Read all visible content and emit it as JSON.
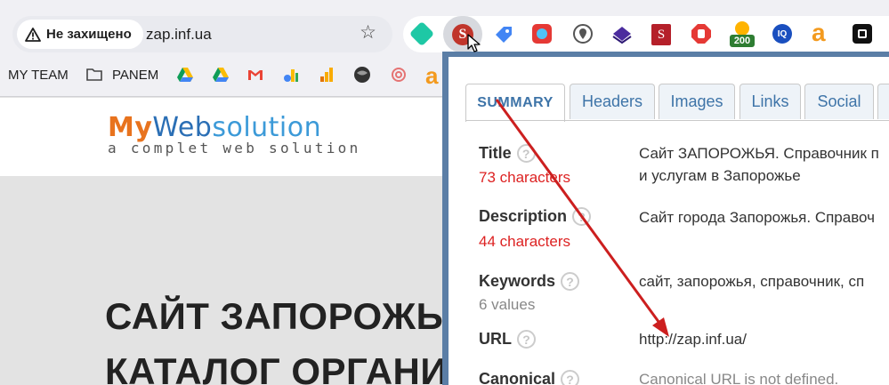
{
  "browser": {
    "security_label": "Не захищено",
    "url": "zap.inf.ua",
    "extensions": [
      {
        "name": "grammar-check-icon",
        "color": "#1ec8a5"
      },
      {
        "name": "seo-meta-icon",
        "color": "#c0352b",
        "label": "SEO"
      },
      {
        "name": "tag-icon",
        "color": "#4285f4"
      },
      {
        "name": "screenshot-icon",
        "color": "#e53935"
      },
      {
        "name": "location-icon",
        "color": "#555555"
      },
      {
        "name": "layers-icon",
        "color": "#4b2c9e"
      },
      {
        "name": "s-extension-icon",
        "color": "#b5202a",
        "label": "S"
      },
      {
        "name": "stop-hand-icon",
        "color": "#e53935"
      },
      {
        "name": "counter-badge-icon",
        "color": "#2e7d32",
        "label": "200"
      },
      {
        "name": "iq-icon",
        "color": "#1a4fbf",
        "label": "IQ"
      },
      {
        "name": "a-letter-icon",
        "color": "#f39a1e",
        "label": "a"
      },
      {
        "name": "chip-icon",
        "color": "#111111"
      }
    ]
  },
  "bookmarks": {
    "items": [
      {
        "label": "MY TEAM"
      },
      {
        "label": "PANEM"
      }
    ]
  },
  "site": {
    "logo_my": "My",
    "logo_web": "Web",
    "logo_solution": "solution",
    "logo_tagline": "a complet web solution",
    "hero_line1": "САЙТ ЗАПОРОЖЬ",
    "hero_line2": "КАТАЛОГ ОРГАНИ"
  },
  "popup": {
    "tabs": [
      {
        "label": "SUMMARY",
        "active": true
      },
      {
        "label": "Headers",
        "active": false
      },
      {
        "label": "Images",
        "active": false
      },
      {
        "label": "Links",
        "active": false
      },
      {
        "label": "Social",
        "active": false
      }
    ],
    "help_glyph": "?",
    "rows": {
      "title": {
        "label": "Title",
        "sub": "73 characters",
        "value_line1": "Сайт ЗАПОРОЖЬЯ. Справочник п",
        "value_line2": "и услугам в Запорожье"
      },
      "description": {
        "label": "Description",
        "sub": "44 characters",
        "value": "Сайт города Запорожья. Справоч"
      },
      "keywords": {
        "label": "Keywords",
        "sub": "6 values",
        "value": "сайт, запорожья, справочник, сп"
      },
      "url": {
        "label": "URL",
        "value": "http://zap.inf.ua/"
      },
      "canonical": {
        "label": "Canonical",
        "value": "Canonical URL is not defined."
      }
    }
  },
  "colors": {
    "annotation_arrow": "#cc1f1f",
    "popup_frame": "#5b7ea6",
    "tab_text": "#3e74a8"
  }
}
